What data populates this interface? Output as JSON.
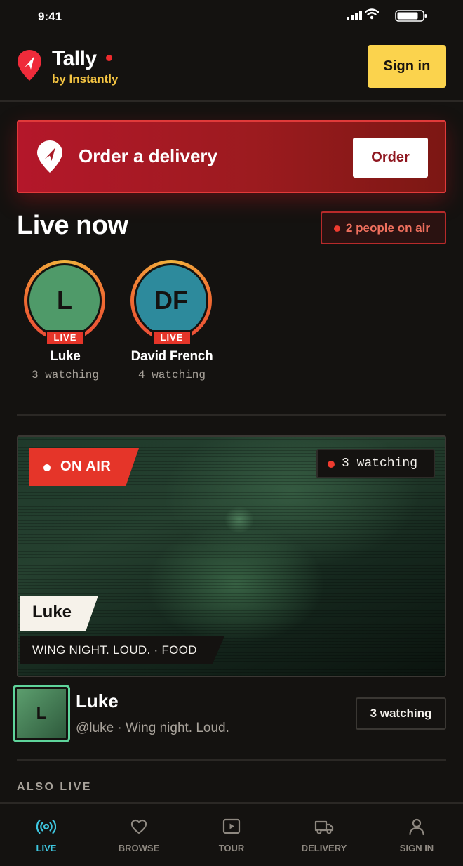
{
  "status_bar": {
    "time": "9:41"
  },
  "header": {
    "brand": "Tally",
    "subtitle": "by Instantly",
    "signin_label": "Sign in"
  },
  "order_banner": {
    "title": "Order a delivery",
    "button_label": "Order"
  },
  "live_now": {
    "title": "Live now",
    "on_air_count": "2 people on air",
    "streamers": [
      {
        "initials": "L",
        "badge": "LIVE",
        "name": "Luke",
        "watching": "3 watching",
        "avatar_color": "#4f9a69"
      },
      {
        "initials": "DF",
        "badge": "LIVE",
        "name": "David French",
        "watching": "4 watching",
        "avatar_color": "#2d8a9c"
      }
    ]
  },
  "featured": {
    "badge": "ON AIR",
    "watching": "3 watching",
    "name": "Luke",
    "caption": "WING NIGHT. LOUD. · FOOD",
    "host_initial": "L",
    "host_name": "Luke",
    "host_meta": "@luke · Wing night. Loud.",
    "host_watching": "3 watching"
  },
  "also_live": {
    "title": "ALSO LIVE"
  },
  "bottom_nav": [
    {
      "label": "LIVE",
      "icon": "broadcast-icon",
      "active": true
    },
    {
      "label": "BROWSE",
      "icon": "heart-icon",
      "active": false
    },
    {
      "label": "TOUR",
      "icon": "play-icon",
      "active": false
    },
    {
      "label": "DELIVERY",
      "icon": "truck-icon",
      "active": false
    },
    {
      "label": "SIGN IN",
      "icon": "user-icon",
      "active": false
    }
  ],
  "colors": {
    "background": "#141210",
    "accent_red": "#e53529",
    "accent_yellow": "#fbd34d",
    "accent_cyan": "#3ec7e0",
    "accent_green": "#5fd49b"
  }
}
